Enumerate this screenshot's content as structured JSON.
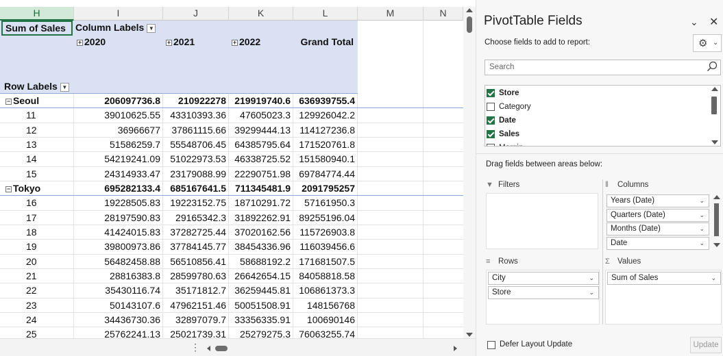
{
  "sheet": {
    "columns": [
      {
        "letter": "H",
        "selected": true
      },
      {
        "letter": "I",
        "selected": false
      },
      {
        "letter": "J",
        "selected": false
      },
      {
        "letter": "K",
        "selected": false
      },
      {
        "letter": "L",
        "selected": false
      },
      {
        "letter": "M",
        "selected": false
      },
      {
        "letter": "N",
        "selected": false
      }
    ],
    "pivot": {
      "sum_label": "Sum of Sales",
      "column_labels": "Column Labels",
      "years": [
        "2020",
        "2021",
        "2022"
      ],
      "grand_total": "Grand Total",
      "row_labels": "Row Labels",
      "rows": [
        {
          "label": "Seoul",
          "group": true,
          "values": [
            "206097736.8",
            "210922278",
            "219919740.6",
            "636939755.4"
          ]
        },
        {
          "label": "11",
          "group": false,
          "values": [
            "39010625.55",
            "43310393.36",
            "47605023.3",
            "129926042.2"
          ]
        },
        {
          "label": "12",
          "group": false,
          "values": [
            "36966677",
            "37861115.66",
            "39299444.13",
            "114127236.8"
          ]
        },
        {
          "label": "13",
          "group": false,
          "values": [
            "51586259.7",
            "55548706.45",
            "64385795.64",
            "171520761.8"
          ]
        },
        {
          "label": "14",
          "group": false,
          "values": [
            "54219241.09",
            "51022973.53",
            "46338725.52",
            "151580940.1"
          ]
        },
        {
          "label": "15",
          "group": false,
          "values": [
            "24314933.47",
            "23179088.99",
            "22290751.98",
            "69784774.44"
          ]
        },
        {
          "label": "Tokyo",
          "group": true,
          "values": [
            "695282133.4",
            "685167641.5",
            "711345481.9",
            "2091795257"
          ]
        },
        {
          "label": "16",
          "group": false,
          "values": [
            "19228505.83",
            "19223152.75",
            "18710291.72",
            "57161950.3"
          ]
        },
        {
          "label": "17",
          "group": false,
          "values": [
            "28197590.83",
            "29165342.3",
            "31892262.91",
            "89255196.04"
          ]
        },
        {
          "label": "18",
          "group": false,
          "values": [
            "41424015.83",
            "37282725.44",
            "37020162.56",
            "115726903.8"
          ]
        },
        {
          "label": "19",
          "group": false,
          "values": [
            "39800973.86",
            "37784145.77",
            "38454336.96",
            "116039456.6"
          ]
        },
        {
          "label": "20",
          "group": false,
          "values": [
            "56482458.88",
            "56510856.41",
            "58688192.2",
            "171681507.5"
          ]
        },
        {
          "label": "21",
          "group": false,
          "values": [
            "28816383.8",
            "28599780.63",
            "26642654.15",
            "84058818.58"
          ]
        },
        {
          "label": "22",
          "group": false,
          "values": [
            "35430116.74",
            "35171812.7",
            "36259445.81",
            "106861373.3"
          ]
        },
        {
          "label": "23",
          "group": false,
          "values": [
            "50143107.6",
            "47962151.46",
            "50051508.91",
            "148156768"
          ]
        },
        {
          "label": "24",
          "group": false,
          "values": [
            "34436730.36",
            "32897079.7",
            "33356335.91",
            "100690146"
          ]
        },
        {
          "label": "25",
          "group": false,
          "values": [
            "25762241.13",
            "25021739.31",
            "25279275.3",
            "76063255.74"
          ]
        }
      ]
    }
  },
  "pane": {
    "title": "PivotTable Fields",
    "choose_label": "Choose fields to add to report:",
    "search_placeholder": "Search",
    "fields": [
      {
        "name": "Store",
        "checked": true
      },
      {
        "name": "Category",
        "checked": false
      },
      {
        "name": "Date",
        "checked": true
      },
      {
        "name": "Sales",
        "checked": true
      },
      {
        "name": "Margin",
        "checked": false
      }
    ],
    "drag_label": "Drag fields between areas below:",
    "areas": {
      "filters": {
        "label": "Filters",
        "items": []
      },
      "columns": {
        "label": "Columns",
        "items": [
          "Years (Date)",
          "Quarters (Date)",
          "Months (Date)",
          "Date"
        ]
      },
      "rows": {
        "label": "Rows",
        "items": [
          "City",
          "Store"
        ]
      },
      "values": {
        "label": "Values",
        "items": [
          "Sum of Sales"
        ]
      }
    },
    "defer_label": "Defer Layout Update",
    "update_label": "Update"
  }
}
